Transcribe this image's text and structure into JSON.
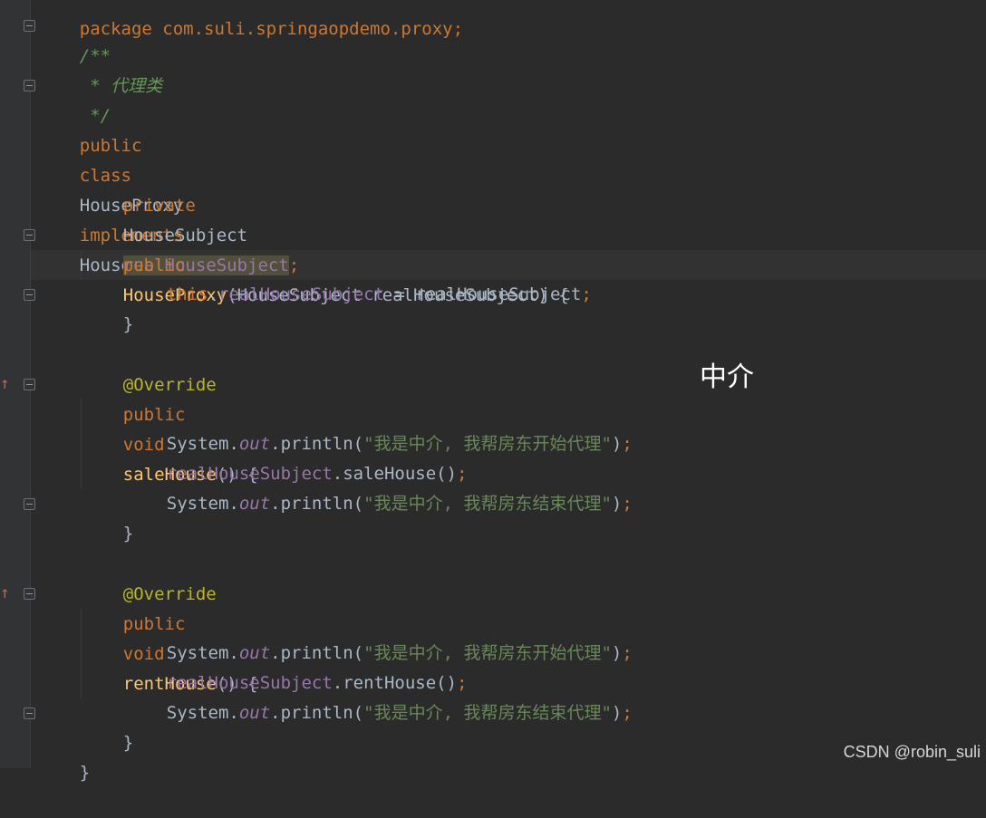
{
  "editor": {
    "lines": {
      "package": "package com.suli.springaopdemo.proxy;",
      "javadoc_start": "/**",
      "javadoc_mid": " * 代理类",
      "javadoc_end": " */",
      "class_decl": {
        "kw1": "public",
        "kw2": "class",
        "name": "HouseProxy",
        "kw3": "implements",
        "iface": "HouseSubject{"
      },
      "field_decl": {
        "kw": "private",
        "type": "HouseSubject",
        "name": "realHouseSubject",
        "semicolon": ";"
      },
      "ctor_decl": {
        "kw": "public",
        "name": "HouseProxy",
        "params": "(HouseSubject realHouseSubject) {"
      },
      "ctor_body": {
        "this": "this",
        "dot": ".",
        "field": "realHouseSubject",
        "rest": " = realHouseSubject",
        "semicolon": ";"
      },
      "close_brace": "}",
      "override": "@Override",
      "sale_decl": {
        "kw1": "public",
        "kw2": "void",
        "name": "saleHouse",
        "rest": "() {"
      },
      "sale_line1": {
        "obj": "System.",
        "static": "out",
        "call": ".println(",
        "str": "\"我是中介, 我帮房东开始代理\"",
        "end": ")",
        "semicolon": ";"
      },
      "sale_line2": {
        "field": "realHouseSubject",
        "call": ".saleHouse()",
        "semicolon": ";"
      },
      "sale_line3": {
        "obj": "System.",
        "static": "out",
        "call": ".println(",
        "str": "\"我是中介, 我帮房东结束代理\"",
        "end": ")",
        "semicolon": ";"
      },
      "rent_decl": {
        "kw1": "public",
        "kw2": "void",
        "name": "rentHouse",
        "rest": "() {"
      },
      "rent_line1": {
        "obj": "System.",
        "static": "out",
        "call": ".println(",
        "str": "\"我是中介, 我帮房东开始代理\"",
        "end": ")",
        "semicolon": ";"
      },
      "rent_line2": {
        "field": "realHouseSubject",
        "call": ".rentHouse()",
        "semicolon": ";"
      },
      "rent_line3": {
        "obj": "System.",
        "static": "out",
        "call": ".println(",
        "str": "\"我是中介, 我帮房东结束代理\"",
        "end": ")",
        "semicolon": ";"
      }
    }
  },
  "overlay": {
    "label": "中介"
  },
  "watermark": {
    "text": "CSDN @robin_suli"
  },
  "icons": {
    "fold": "fold-icon",
    "override": "override-arrow-icon"
  }
}
